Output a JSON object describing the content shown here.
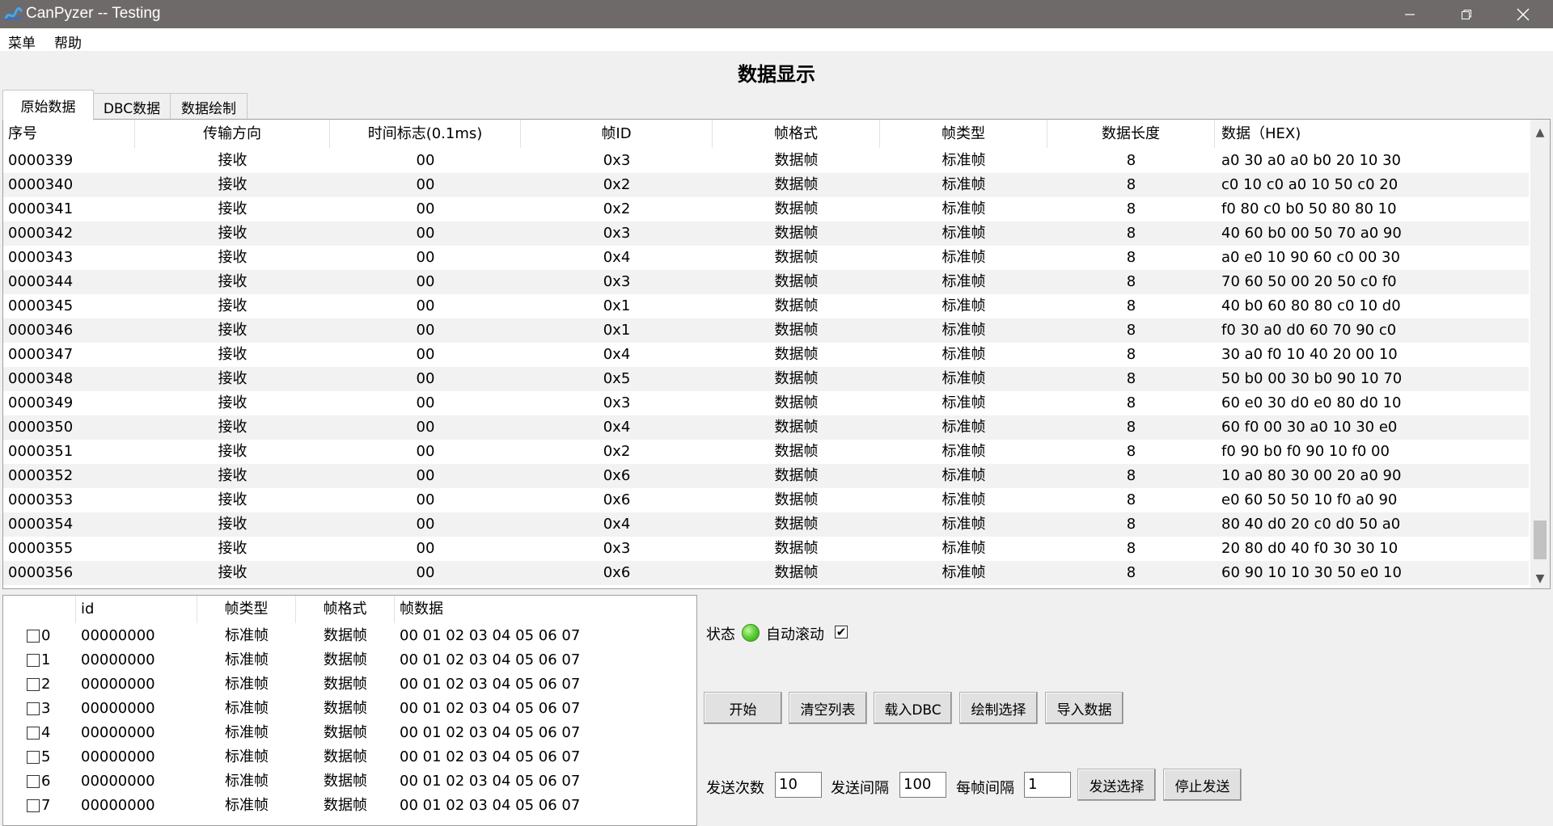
{
  "window": {
    "title": "CanPyzer -- Testing"
  },
  "menu": {
    "items": [
      "菜单",
      "帮助"
    ]
  },
  "page_title": "数据显示",
  "tabs": [
    "原始数据",
    "DBC数据",
    "数据绘制"
  ],
  "table": {
    "headers": [
      "序号",
      "传输方向",
      "时间标志(0.1ms)",
      "帧ID",
      "帧格式",
      "帧类型",
      "数据长度",
      "数据（HEX)"
    ],
    "rows": [
      [
        "0000339",
        "接收",
        "00",
        "0x3",
        "数据帧",
        "标准帧",
        "8",
        "a0 30 a0 a0 b0 20 10 30"
      ],
      [
        "0000340",
        "接收",
        "00",
        "0x2",
        "数据帧",
        "标准帧",
        "8",
        "c0 10 c0 a0 10 50 c0 20"
      ],
      [
        "0000341",
        "接收",
        "00",
        "0x2",
        "数据帧",
        "标准帧",
        "8",
        "f0 80 c0 b0 50 80 80 10"
      ],
      [
        "0000342",
        "接收",
        "00",
        "0x3",
        "数据帧",
        "标准帧",
        "8",
        "40 60 b0 00 50 70 a0 90"
      ],
      [
        "0000343",
        "接收",
        "00",
        "0x4",
        "数据帧",
        "标准帧",
        "8",
        "a0 e0 10 90 60 c0 00 30"
      ],
      [
        "0000344",
        "接收",
        "00",
        "0x3",
        "数据帧",
        "标准帧",
        "8",
        "70 60 50 00 20 50 c0 f0"
      ],
      [
        "0000345",
        "接收",
        "00",
        "0x1",
        "数据帧",
        "标准帧",
        "8",
        "40 b0 60 80 80 c0 10 d0"
      ],
      [
        "0000346",
        "接收",
        "00",
        "0x1",
        "数据帧",
        "标准帧",
        "8",
        "f0 30 a0 d0 60 70 90 c0"
      ],
      [
        "0000347",
        "接收",
        "00",
        "0x4",
        "数据帧",
        "标准帧",
        "8",
        "30 a0 f0 10 40 20 00 10"
      ],
      [
        "0000348",
        "接收",
        "00",
        "0x5",
        "数据帧",
        "标准帧",
        "8",
        "50 b0 00 30 b0 90 10 70"
      ],
      [
        "0000349",
        "接收",
        "00",
        "0x3",
        "数据帧",
        "标准帧",
        "8",
        "60 e0 30 d0 e0 80 d0 10"
      ],
      [
        "0000350",
        "接收",
        "00",
        "0x4",
        "数据帧",
        "标准帧",
        "8",
        "60 f0 00 30 a0 10 30 e0"
      ],
      [
        "0000351",
        "接收",
        "00",
        "0x2",
        "数据帧",
        "标准帧",
        "8",
        "f0 90 b0 f0 90 10 f0 00"
      ],
      [
        "0000352",
        "接收",
        "00",
        "0x6",
        "数据帧",
        "标准帧",
        "8",
        "10 a0 80 30 00 20 a0 90"
      ],
      [
        "0000353",
        "接收",
        "00",
        "0x6",
        "数据帧",
        "标准帧",
        "8",
        "e0 60 50 50 10 f0 a0 90"
      ],
      [
        "0000354",
        "接收",
        "00",
        "0x4",
        "数据帧",
        "标准帧",
        "8",
        "80 40 d0 20 c0 d0 50 a0"
      ],
      [
        "0000355",
        "接收",
        "00",
        "0x3",
        "数据帧",
        "标准帧",
        "8",
        "20 80 d0 40 f0 30 30 10"
      ],
      [
        "0000356",
        "接收",
        "00",
        "0x6",
        "数据帧",
        "标准帧",
        "8",
        "60 90 10 10 30 50 e0 10"
      ]
    ]
  },
  "send_table": {
    "headers": [
      "id",
      "帧类型",
      "帧格式",
      "帧数据"
    ],
    "rows": [
      [
        "0",
        "00000000",
        "标准帧",
        "数据帧",
        "00 01 02 03 04 05 06 07"
      ],
      [
        "1",
        "00000000",
        "标准帧",
        "数据帧",
        "00 01 02 03 04 05 06 07"
      ],
      [
        "2",
        "00000000",
        "标准帧",
        "数据帧",
        "00 01 02 03 04 05 06 07"
      ],
      [
        "3",
        "00000000",
        "标准帧",
        "数据帧",
        "00 01 02 03 04 05 06 07"
      ],
      [
        "4",
        "00000000",
        "标准帧",
        "数据帧",
        "00 01 02 03 04 05 06 07"
      ],
      [
        "5",
        "00000000",
        "标准帧",
        "数据帧",
        "00 01 02 03 04 05 06 07"
      ],
      [
        "6",
        "00000000",
        "标准帧",
        "数据帧",
        "00 01 02 03 04 05 06 07"
      ],
      [
        "7",
        "00000000",
        "标准帧",
        "数据帧",
        "00 01 02 03 04 05 06 07"
      ]
    ]
  },
  "status": {
    "label": "状态",
    "auto_scroll_label": "自动滚动",
    "auto_scroll_checked": true,
    "led_color": "#5fd23a"
  },
  "buttons": {
    "start": "开始",
    "clear": "清空列表",
    "load_dbc": "载入DBC",
    "plot_select": "绘制选择",
    "import_data": "导入数据"
  },
  "send": {
    "count_label": "发送次数",
    "count_value": "10",
    "interval_label": "发送间隔",
    "interval_value": "100",
    "frame_interval_label": "每帧间隔",
    "frame_interval_value": "1",
    "select_button": "发送选择",
    "stop_button": "停止发送"
  }
}
